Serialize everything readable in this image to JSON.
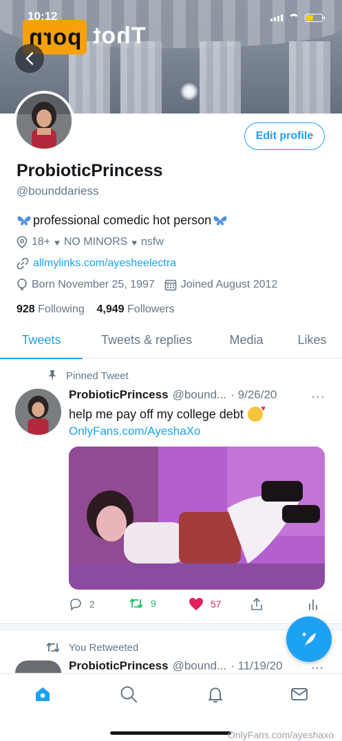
{
  "status_bar": {
    "time": "10:12"
  },
  "watermark": {
    "boxed": "porn",
    "plain": "Thot"
  },
  "profile": {
    "edit_label": "Edit profile",
    "name": "ProbioticPrincess",
    "handle": "@bounddariess",
    "bio": "professional comedic hot person",
    "tags": [
      "18+",
      "NO MINORS",
      "nsfw"
    ],
    "link": "allmylinks.com/ayesheelectra",
    "born": "Born November 25, 1997",
    "joined": "Joined August 2012",
    "following_count": "928",
    "following_label": "Following",
    "followers_count": "4,949",
    "followers_label": "Followers"
  },
  "tabs": [
    {
      "label": "Tweets"
    },
    {
      "label": "Tweets & replies"
    },
    {
      "label": "Media"
    },
    {
      "label": "Likes"
    }
  ],
  "tweets": [
    {
      "context": "Pinned Tweet",
      "name": "ProbioticPrincess",
      "handle": "@bound...",
      "date": "· 9/26/20",
      "text": "help me pay off my college debt",
      "link": "OnlyFans.com/AyeshaXo",
      "replies": "2",
      "retweets": "9",
      "likes": "57"
    },
    {
      "context": "You Retweeted",
      "name": "ProbioticPrincess",
      "handle": "@bound...",
      "date": "· 11/19/20"
    }
  ],
  "footer_watermark": "OnlyFans.com/ayeshaxo",
  "colors": {
    "accent": "#1da1f2",
    "like": "#e0245e",
    "retweet": "#17bf63",
    "muted": "#657786"
  }
}
